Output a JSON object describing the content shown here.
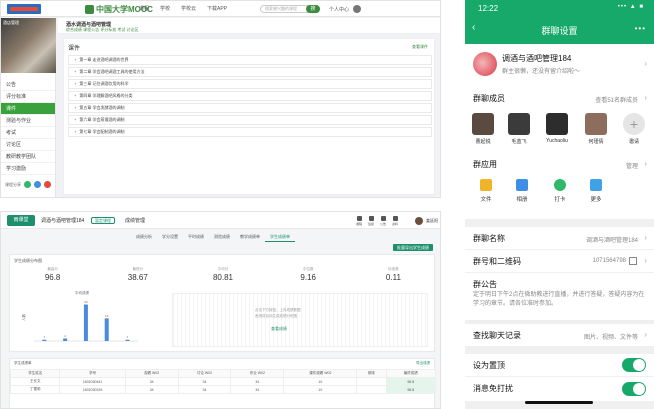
{
  "mooc": {
    "brand": "中国大学MOOC",
    "nav": [
      "课程",
      "学校",
      "学校云",
      "下载APP"
    ],
    "search_placeholder": "搜索感兴趣的课程",
    "search_button": "搜",
    "user": "个人中心",
    "cover_text": "酒店管理",
    "course_title": "酒水调酒与酒吧管理",
    "course_meta": "综合成绩  课程公告  评分标准  考试  讨论区",
    "menu": [
      "公告",
      "评分标准",
      "课件",
      "测验与作业",
      "考试",
      "讨论区",
      "教研教学团队",
      "学习激励"
    ],
    "share_label": "课程分享",
    "section": "课件",
    "section_link": "查看课件",
    "chapters": [
      "第一章 走进酒吧调酒的世界",
      "第二章 学会酒吧调酒工具的使用方法",
      "第三章 记住调酒饮用的科学",
      "第四章 学理解酒吧风格的分类",
      "第五章 学会发酵酒的调制",
      "第六章 学会蒸馏酒的调制",
      "第七章 学会配制酒的调制"
    ]
  },
  "rain": {
    "logo": "雨课堂",
    "course": "调酒与酒吧管理184",
    "tag": "暂定课程",
    "manager": "成绩管理",
    "tools": [
      "课程",
      "班级",
      "公告",
      "资料"
    ],
    "user": "姜廷阳",
    "tabs": [
      "成绩分析",
      "学分设置",
      "平时成绩",
      "测验成绩",
      "教学成绩单",
      "学生成绩单"
    ],
    "active_tab": 5,
    "export_label": "批量导出学生成绩",
    "card_title": "学生成绩分布图",
    "stats": [
      {
        "label": "最高分",
        "value": "96.8"
      },
      {
        "label": "最低分",
        "value": "38.67"
      },
      {
        "label": "平均分",
        "value": "80.81"
      },
      {
        "label": "中位数",
        "value": "9.16"
      },
      {
        "label": "标准差",
        "value": "0.11"
      }
    ],
    "chart_label": "平均成绩",
    "chart_ylabel": "人数",
    "chart_bar_labels": [
      "1",
      "2",
      "29",
      "18",
      "1"
    ],
    "scatter_text1": "点击下方按钮，上传成绩数据",
    "scatter_text2": "系统将自动生成成绩分布图",
    "scatter_link": "查看成绩",
    "table_title": "学生成绩单",
    "table_link": "导出成绩",
    "table_headers": [
      "学生姓名",
      "学号",
      "观看 W02",
      "讨论 W02",
      "作业 W02",
      "课件观看 W02",
      "期末",
      "最终成绩"
    ],
    "table_group": "平时成绩 W03",
    "rows": [
      [
        "王长文",
        "1602030441",
        "34",
        "34",
        "34",
        "10",
        "",
        "96.8"
      ],
      [
        "丁雪莉",
        "1602030315",
        "34",
        "34",
        "34",
        "10",
        "",
        "96.8"
      ]
    ]
  },
  "wechat": {
    "time": "12:22",
    "status": "••• ▲ ■",
    "title": "群聊设置",
    "group_name": "调酒与酒吧管理184",
    "group_sub": "群主很懒，还没有留介绍啦～",
    "members_label": "群聊成员",
    "members_more": "查看51名群成员",
    "members": [
      {
        "name": "曹起锐",
        "color": "#5a4a3f"
      },
      {
        "name": "毛蓝飞",
        "color": "#3b3b3b"
      },
      {
        "name": "Yuchaoliu",
        "color": "#2d2d2d"
      },
      {
        "name": "何瑾倩",
        "color": "#8c6d5e"
      },
      {
        "name": "邀请",
        "color": "#e5e5e5"
      }
    ],
    "apps_label": "群应用",
    "apps_manage": "管理",
    "apps": [
      {
        "name": "文件",
        "color": "#f0b429"
      },
      {
        "name": "相册",
        "color": "#3f8ee6"
      },
      {
        "name": "打卡",
        "color": "#2fb86a"
      },
      {
        "name": "更多",
        "color": "#3fa1e6"
      }
    ],
    "name_label": "群聊名称",
    "name_value": "调酒与酒吧管理184",
    "qr_label": "群号和二维码",
    "qr_value": "1071564798",
    "notice_label": "群公告",
    "notice_text": "定于明日下午2点在微助教进行直播，并进行答疑，答疑内容为在学习的章节。请各位准时参加。",
    "history_label": "查找聊天记录",
    "history_value": "图片、视频、文件等",
    "top_label": "设为置顶",
    "dnd_label": "消息免打扰"
  },
  "chart_data": {
    "type": "bar",
    "categories": [
      "0-20",
      "20-40",
      "40-60",
      "60-80",
      "80-100"
    ],
    "values": [
      1,
      2,
      29,
      18,
      1
    ],
    "title": "平均成绩",
    "xlabel": "",
    "ylabel": "人数",
    "ylim": [
      0,
      35
    ]
  }
}
